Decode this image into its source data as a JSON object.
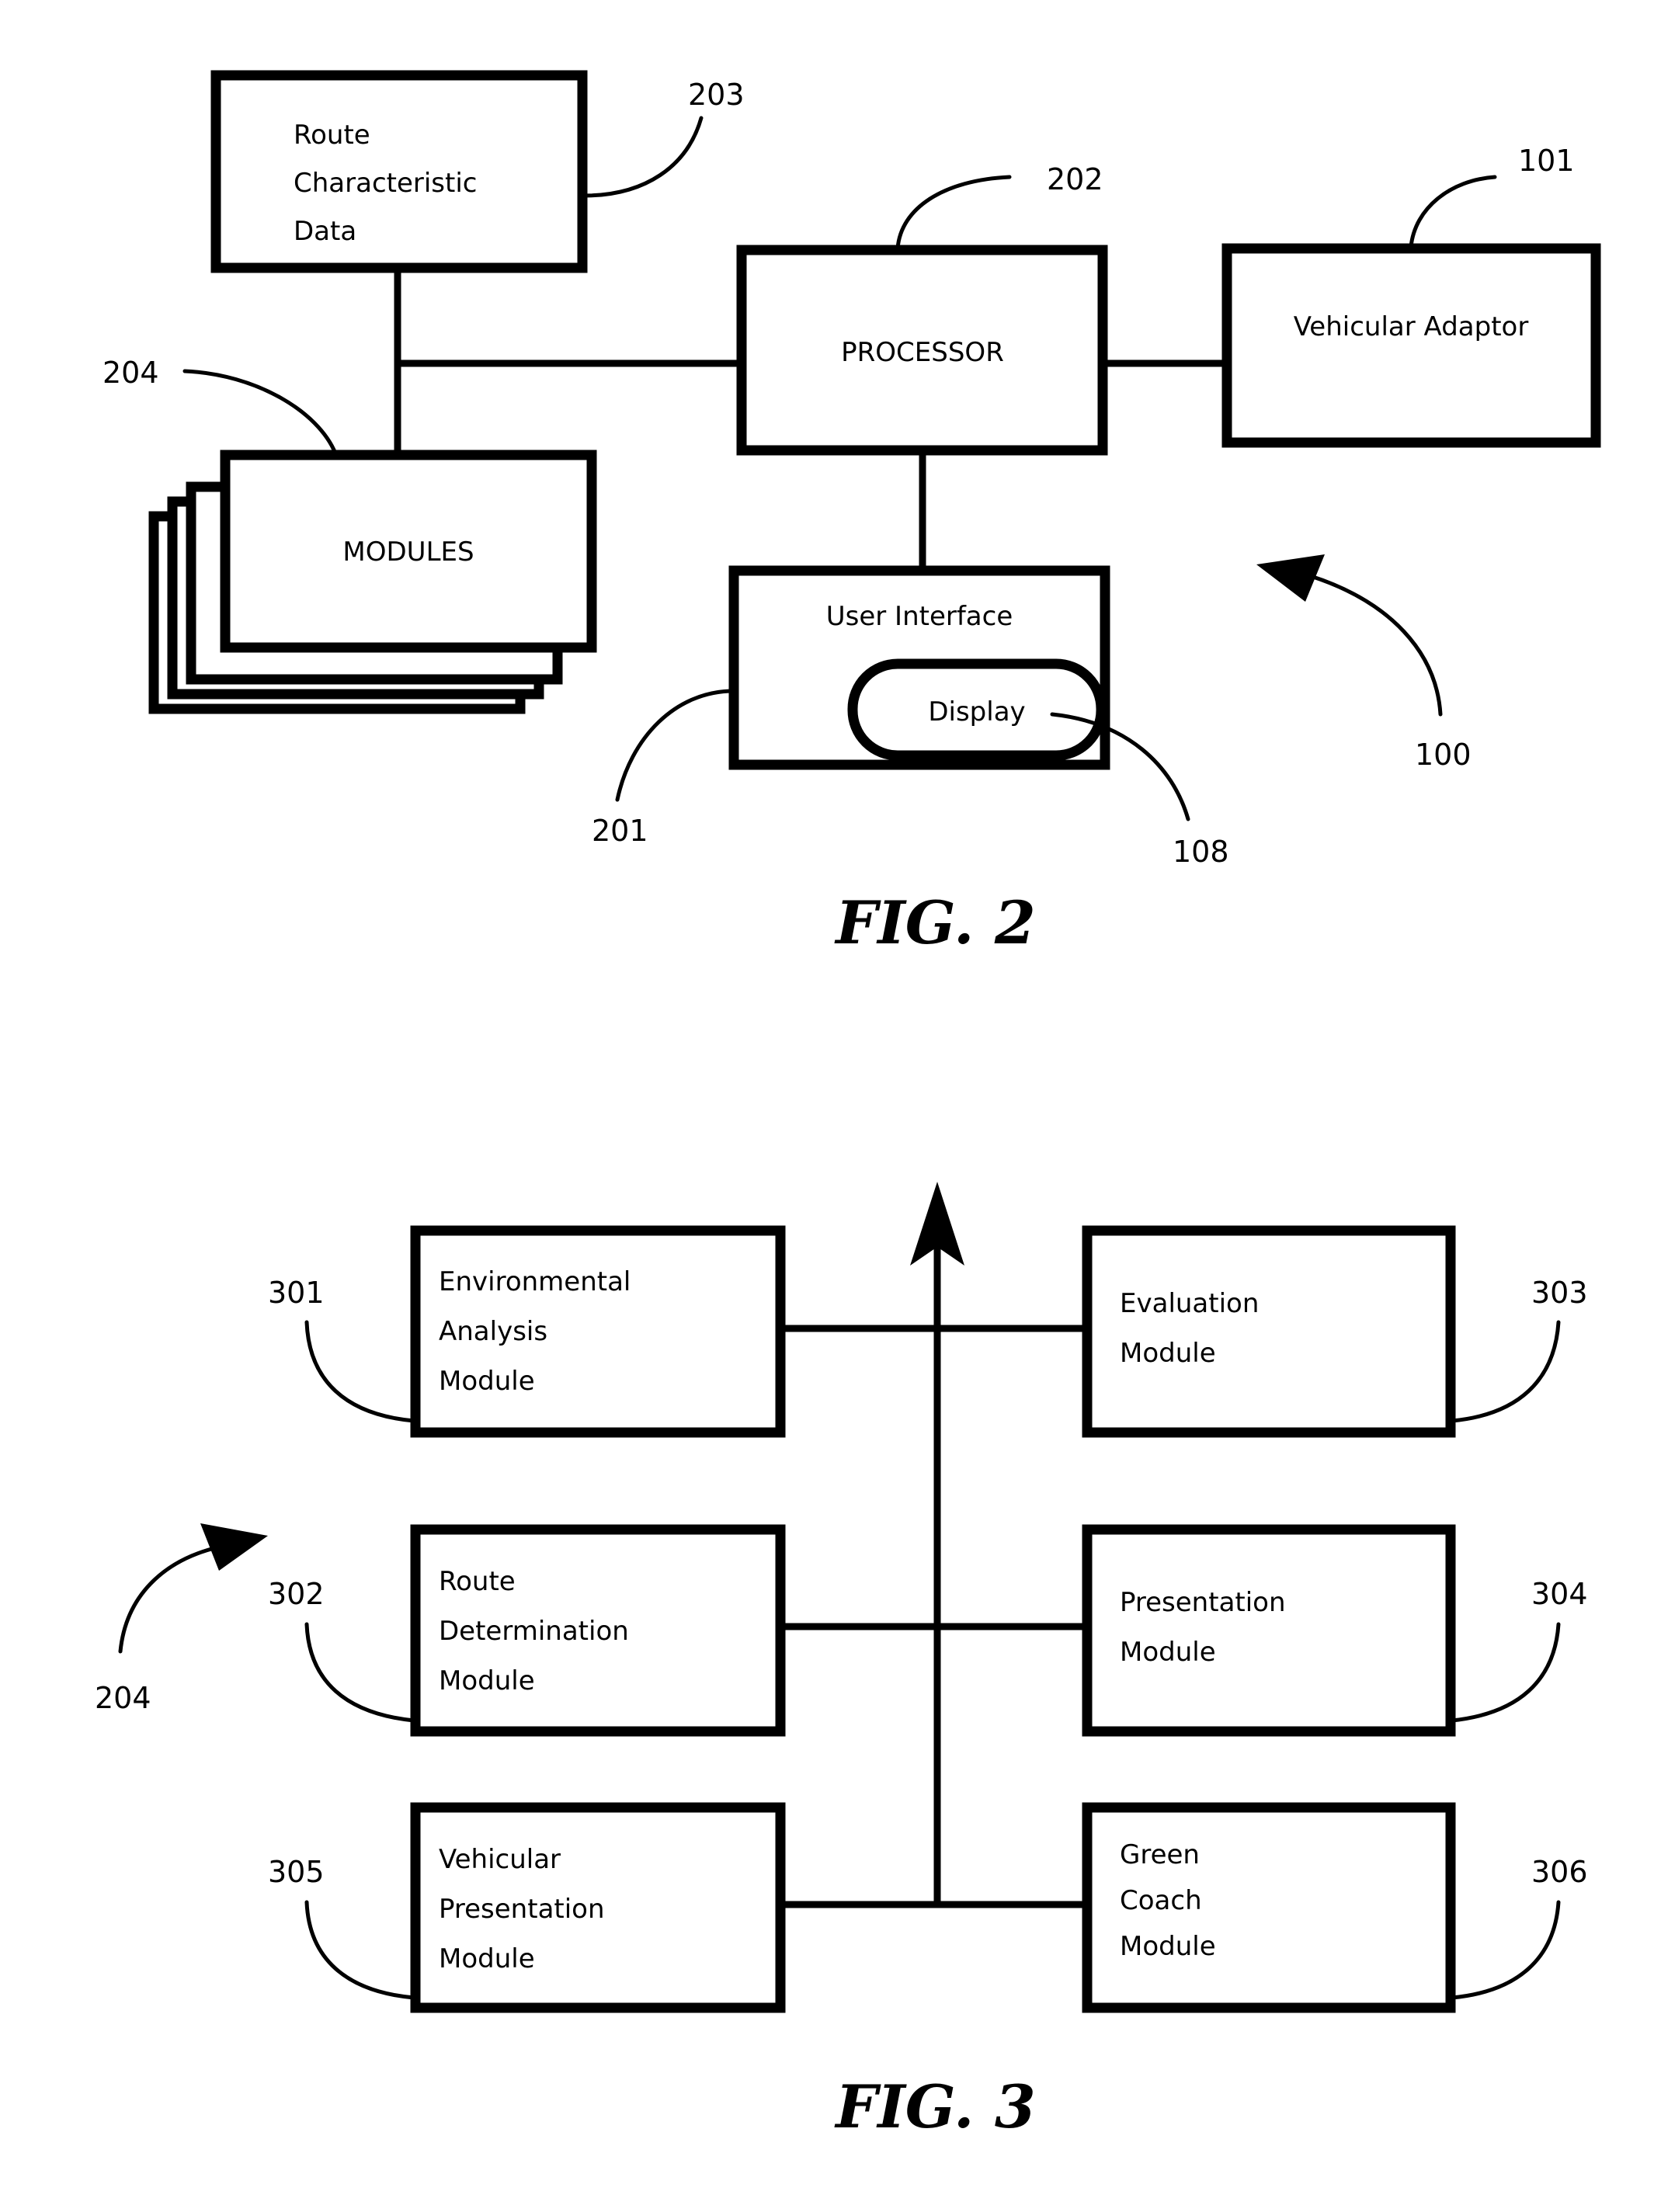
{
  "document": {
    "type": "patent-drawing-sheet",
    "figures": [
      "FIG. 2",
      "FIG. 3"
    ]
  },
  "figure2": {
    "caption": "FIG. 2",
    "system_ref": "100",
    "boxes": {
      "route_characteristic_data": {
        "lines": [
          "Route",
          "Characteristic",
          "Data"
        ],
        "ref": "203"
      },
      "modules": {
        "label": "MODULES",
        "ref": "204"
      },
      "processor": {
        "label": "PROCESSOR",
        "ref": "202"
      },
      "vehicular_adaptor": {
        "label": "Vehicular Adaptor",
        "ref": "101"
      },
      "user_interface": {
        "label": "User Interface",
        "ref": "201"
      },
      "display": {
        "label": "Display",
        "ref": "108"
      }
    }
  },
  "figure3": {
    "caption": "FIG. 3",
    "system_ref": "204",
    "boxes": {
      "environmental_analysis_module": {
        "lines": [
          "Environmental",
          "Analysis",
          "Module"
        ],
        "ref": "301"
      },
      "route_determination_module": {
        "lines": [
          "Route",
          "Determination",
          "Module"
        ],
        "ref": "302"
      },
      "vehicular_presentation_module": {
        "lines": [
          "Vehicular",
          "Presentation",
          "Module"
        ],
        "ref": "305"
      },
      "evaluation_module": {
        "lines": [
          "Evaluation",
          "Module"
        ],
        "ref": "303"
      },
      "presentation_module": {
        "lines": [
          "Presentation",
          "Module"
        ],
        "ref": "304"
      },
      "green_coach_module": {
        "lines": [
          "Green",
          "Coach",
          "Module"
        ],
        "ref": "306"
      }
    }
  }
}
